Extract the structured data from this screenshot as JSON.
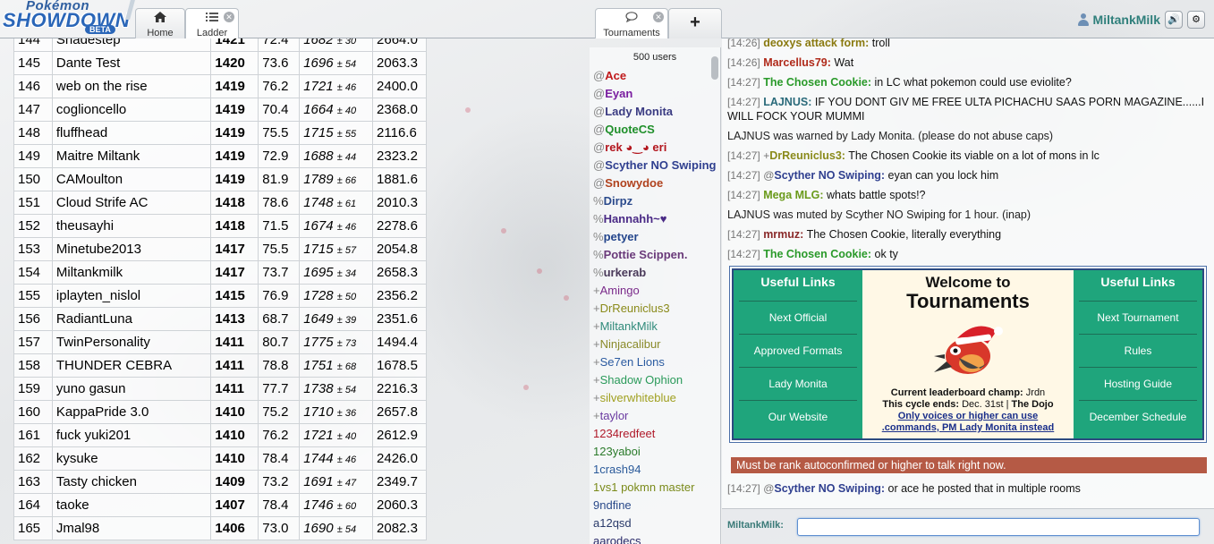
{
  "header": {
    "logo": {
      "top": "Pokémon",
      "main": "SHOWDOWN",
      "badge": "BETA"
    },
    "tabs": [
      {
        "label": "Home",
        "icon": "home-icon"
      },
      {
        "label": "Ladder",
        "icon": "list-icon"
      },
      {
        "label": "Tournaments",
        "icon": "chat-bubble-icon"
      }
    ],
    "new_tab": "+",
    "username": "MiltankMilk",
    "sound_icon": "🔊",
    "settings_icon": "⚙"
  },
  "ladder": {
    "rows": [
      {
        "rank": "144",
        "name": "Shadestep",
        "elo": "1421",
        "gxe": "72.4",
        "glicko": "1682",
        "dev": "± 30",
        "coil": "2664.0"
      },
      {
        "rank": "145",
        "name": "Dante Test",
        "elo": "1420",
        "gxe": "73.6",
        "glicko": "1696",
        "dev": "± 54",
        "coil": "2063.3"
      },
      {
        "rank": "146",
        "name": "web on the rise",
        "elo": "1419",
        "gxe": "76.2",
        "glicko": "1721",
        "dev": "± 46",
        "coil": "2400.0"
      },
      {
        "rank": "147",
        "name": "coglioncello",
        "elo": "1419",
        "gxe": "70.4",
        "glicko": "1664",
        "dev": "± 40",
        "coil": "2368.0"
      },
      {
        "rank": "148",
        "name": "fluffhead",
        "elo": "1419",
        "gxe": "75.5",
        "glicko": "1715",
        "dev": "± 55",
        "coil": "2116.6"
      },
      {
        "rank": "149",
        "name": "Maitre Miltank",
        "elo": "1419",
        "gxe": "72.9",
        "glicko": "1688",
        "dev": "± 44",
        "coil": "2323.2"
      },
      {
        "rank": "150",
        "name": "CAMoulton",
        "elo": "1419",
        "gxe": "81.9",
        "glicko": "1789",
        "dev": "± 66",
        "coil": "1881.6"
      },
      {
        "rank": "151",
        "name": "Cloud Strife AC",
        "elo": "1418",
        "gxe": "78.6",
        "glicko": "1748",
        "dev": "± 61",
        "coil": "2010.3"
      },
      {
        "rank": "152",
        "name": "theusayhi",
        "elo": "1418",
        "gxe": "71.5",
        "glicko": "1674",
        "dev": "± 46",
        "coil": "2278.6"
      },
      {
        "rank": "153",
        "name": "Minetube2013",
        "elo": "1417",
        "gxe": "75.5",
        "glicko": "1715",
        "dev": "± 57",
        "coil": "2054.8"
      },
      {
        "rank": "154",
        "name": "Miltankmilk",
        "elo": "1417",
        "gxe": "73.7",
        "glicko": "1695",
        "dev": "± 34",
        "coil": "2658.3"
      },
      {
        "rank": "155",
        "name": "iplayten_nislol",
        "elo": "1415",
        "gxe": "76.9",
        "glicko": "1728",
        "dev": "± 50",
        "coil": "2356.2"
      },
      {
        "rank": "156",
        "name": "RadiantLuna",
        "elo": "1413",
        "gxe": "68.7",
        "glicko": "1649",
        "dev": "± 39",
        "coil": "2351.6"
      },
      {
        "rank": "157",
        "name": "TwinPersonality",
        "elo": "1411",
        "gxe": "80.7",
        "glicko": "1775",
        "dev": "± 73",
        "coil": "1494.4"
      },
      {
        "rank": "158",
        "name": "THUNDER CEBRA",
        "elo": "1411",
        "gxe": "78.8",
        "glicko": "1751",
        "dev": "± 68",
        "coil": "1678.5"
      },
      {
        "rank": "159",
        "name": "yuno gasun",
        "elo": "1411",
        "gxe": "77.7",
        "glicko": "1738",
        "dev": "± 54",
        "coil": "2216.3"
      },
      {
        "rank": "160",
        "name": "KappaPride 3.0",
        "elo": "1410",
        "gxe": "75.2",
        "glicko": "1710",
        "dev": "± 36",
        "coil": "2657.8"
      },
      {
        "rank": "161",
        "name": "fuck yuki201",
        "elo": "1410",
        "gxe": "76.2",
        "glicko": "1721",
        "dev": "± 40",
        "coil": "2612.9"
      },
      {
        "rank": "162",
        "name": "kysuke",
        "elo": "1410",
        "gxe": "78.4",
        "glicko": "1744",
        "dev": "± 46",
        "coil": "2426.0"
      },
      {
        "rank": "163",
        "name": "Tasty chicken",
        "elo": "1409",
        "gxe": "73.2",
        "glicko": "1691",
        "dev": "± 47",
        "coil": "2349.7"
      },
      {
        "rank": "164",
        "name": "taoke",
        "elo": "1407",
        "gxe": "78.4",
        "glicko": "1746",
        "dev": "± 60",
        "coil": "2060.3"
      },
      {
        "rank": "165",
        "name": "Jmal98",
        "elo": "1406",
        "gxe": "73.0",
        "glicko": "1690",
        "dev": "± 54",
        "coil": "2082.3"
      }
    ]
  },
  "userlist": {
    "count": "500 users",
    "users": [
      {
        "rank": "@",
        "name": "Ace",
        "color": "#c0191b",
        "auth": true
      },
      {
        "rank": "@",
        "name": "Eyan",
        "color": "#7a1ea0",
        "auth": true
      },
      {
        "rank": "@",
        "name": "Lady Monita",
        "color": "#3a3b82",
        "auth": true
      },
      {
        "rank": "@",
        "name": "QuoteCS",
        "color": "#1f8f2a",
        "auth": true
      },
      {
        "rank": "@",
        "name": "rek ◕‿◕ eri",
        "color": "#b3161e",
        "auth": true
      },
      {
        "rank": "@",
        "name": "Scyther NO Swiping",
        "color": "#2f3f8f",
        "auth": true
      },
      {
        "rank": "@",
        "name": "Snowydoe",
        "color": "#b0421e",
        "auth": true
      },
      {
        "rank": "%",
        "name": "Dirpz",
        "color": "#2b4a8c",
        "auth": true
      },
      {
        "rank": "%",
        "name": "Hannahh~♥",
        "color": "#4a2a86",
        "auth": true
      },
      {
        "rank": "%",
        "name": "petyer",
        "color": "#23458c",
        "auth": true
      },
      {
        "rank": "%",
        "name": "Pottie Scippen.",
        "color": "#6a3a7a",
        "auth": true
      },
      {
        "rank": "%",
        "name": "urkerab",
        "color": "#4a3a5a",
        "auth": true
      },
      {
        "rank": "+",
        "name": "Amingo",
        "color": "#7a2a8a",
        "auth": false
      },
      {
        "rank": "+",
        "name": "DrReuniclus3",
        "color": "#8a8a1a",
        "auth": false
      },
      {
        "rank": "+",
        "name": "MiltankMilk",
        "color": "#2f8a7a",
        "auth": false
      },
      {
        "rank": "+",
        "name": "Ninjacalibur",
        "color": "#8a8a2a",
        "auth": false
      },
      {
        "rank": "+",
        "name": "Se7en Lions",
        "color": "#2a5aa0",
        "auth": false
      },
      {
        "rank": "+",
        "name": "Shadow Ophion",
        "color": "#2a9a5a",
        "auth": false
      },
      {
        "rank": "+",
        "name": "silverwhiteblue",
        "color": "#a0a020",
        "auth": false
      },
      {
        "rank": "+",
        "name": "taylor",
        "color": "#6a3aa0",
        "auth": false
      },
      {
        "rank": "",
        "name": "1234redfeet",
        "color": "#b01a2a",
        "auth": false
      },
      {
        "rank": "",
        "name": "123yaboi",
        "color": "#2a7a2a",
        "auth": false
      },
      {
        "rank": "",
        "name": "1crash94",
        "color": "#2a5a9a",
        "auth": false
      },
      {
        "rank": "",
        "name": "1vs1 pokmn master",
        "color": "#7a8a1a",
        "auth": false
      },
      {
        "rank": "",
        "name": "9ndfine",
        "color": "#2a4a8a",
        "auth": false
      },
      {
        "rank": "",
        "name": "a12qsd",
        "color": "#2a3a6a",
        "auth": false
      },
      {
        "rank": "",
        "name": "aarodecs",
        "color": "#2a2a6a",
        "auth": false
      }
    ]
  },
  "chat": {
    "messages": [
      {
        "time": "[14:26]",
        "rank": "",
        "name": "deoxys attack form:",
        "text": "troll",
        "color": "#8a7a10"
      },
      {
        "time": "[14:26]",
        "rank": "",
        "name": "Marcellus79:",
        "text": "Wat",
        "color": "#b02a1a"
      },
      {
        "time": "[14:27]",
        "rank": "",
        "name": "The Chosen Cookie:",
        "text": "in LC what pokemon could use eviolite?",
        "color": "#2a9a2a"
      },
      {
        "time": "[14:27]",
        "rank": "",
        "name": "LAJNUS:",
        "text": "IF YOU DONT GIV ME FREE ULTA PICHACHU SAAS PORN MAGAZINE......I WILL FOCK YOUR MUMMI",
        "color": "#2a6a7a"
      },
      {
        "notice": "LAJNUS was warned by Lady Monita. (please do not abuse caps)"
      },
      {
        "time": "[14:27]",
        "rank": "+",
        "name": "DrReuniclus3:",
        "text": "The Chosen Cookie its viable on a lot of mons in lc",
        "color": "#8a8a1a"
      },
      {
        "time": "[14:27]",
        "rank": "@",
        "name": "Scyther NO Swiping:",
        "text": "eyan can you lock him",
        "color": "#2f3f8f"
      },
      {
        "time": "[14:27]",
        "rank": "",
        "name": "Mega MLG:",
        "text": "whats battle spots!?",
        "color": "#6a9a1a"
      },
      {
        "notice": "LAJNUS was muted by Scyther NO Swiping for 1 hour. (inap)"
      },
      {
        "time": "[14:27]",
        "rank": "",
        "name": "mrmuz:",
        "text": "The Chosen Cookie, literally everything",
        "color": "#8a2a2a"
      },
      {
        "time": "[14:27]",
        "rank": "",
        "name": "The Chosen Cookie:",
        "text": "ok ty",
        "color": "#2a9a2a"
      }
    ],
    "after_messages": [
      {
        "time": "[14:27]",
        "rank": "@",
        "name": "Scyther NO Swiping:",
        "text": "or ace he posted that in multiple rooms",
        "color": "#2f3f8f"
      }
    ],
    "tour_box": {
      "left_header": "Useful Links",
      "left_links": [
        "Next Official",
        "Approved Formats",
        "Lady Monita",
        "Our Website"
      ],
      "right_header": "Useful Links",
      "right_links": [
        "Next Tournament",
        "Rules",
        "Hosting Guide",
        "December Schedule"
      ],
      "welcome": "Welcome to",
      "title": "Tournaments",
      "champ_label": "Current leaderboard champ:",
      "champ": "Jrdn",
      "cycle_label": "This cycle ends:",
      "cycle": "Dec. 31st",
      "sep": "|",
      "dojo": "The Dojo",
      "notice_line1": "Only voices or higher can use",
      "notice_line2": ".commands, PM Lady Monita instead"
    },
    "warning": "Must be rank autoconfirmed or higher to talk right now.",
    "input_label": "MiltankMilk:",
    "input_value": ""
  },
  "colors": {
    "accent_green": "#1fa57c",
    "warning_bg": "#b55a45",
    "username": "#2f7f7b"
  }
}
